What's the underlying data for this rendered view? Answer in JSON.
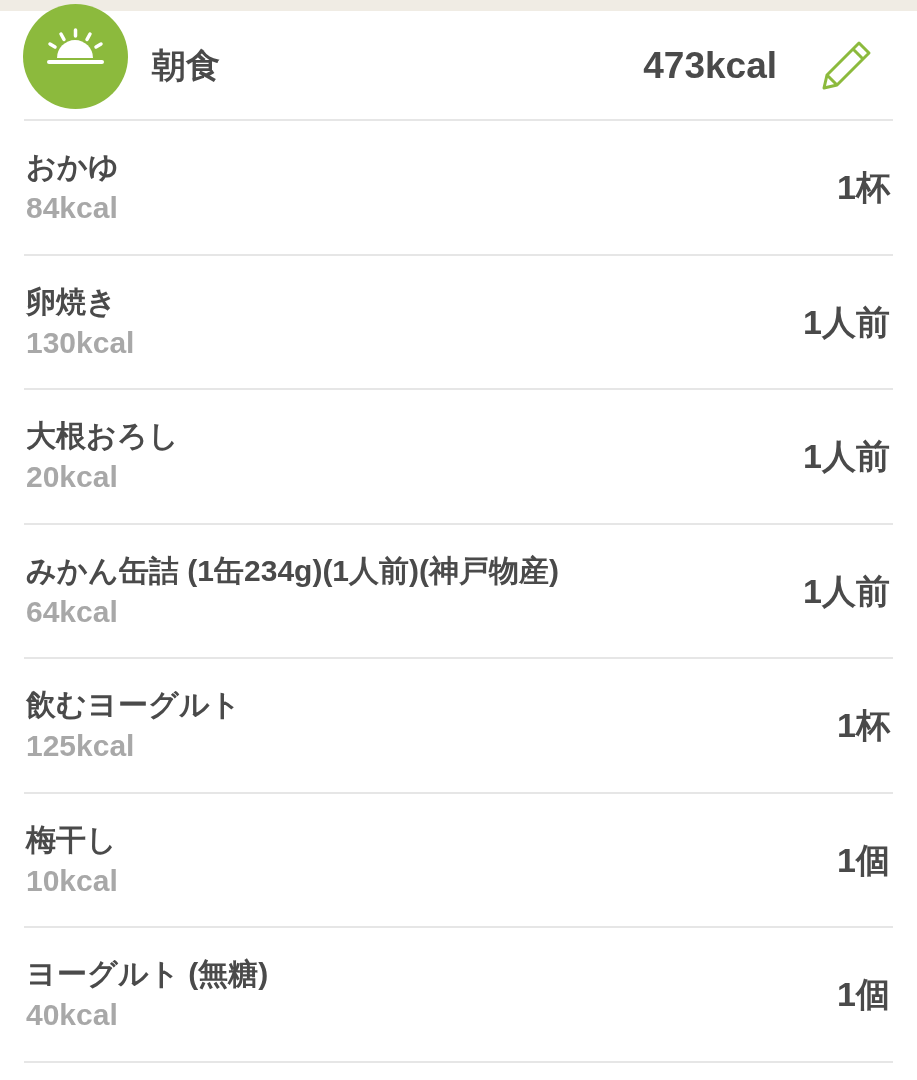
{
  "meal": {
    "title": "朝食",
    "total": "473kcal"
  },
  "items": [
    {
      "name": "おかゆ",
      "calories": "84kcal",
      "quantity": "1杯"
    },
    {
      "name": "卵焼き",
      "calories": "130kcal",
      "quantity": "1人前"
    },
    {
      "name": "大根おろし",
      "calories": "20kcal",
      "quantity": "1人前"
    },
    {
      "name": "みかん缶詰 (1缶234g)(1人前)(神戸物産)",
      "calories": "64kcal",
      "quantity": "1人前"
    },
    {
      "name": "飲むヨーグルト",
      "calories": "125kcal",
      "quantity": "1杯"
    },
    {
      "name": "梅干し",
      "calories": "10kcal",
      "quantity": "1個"
    },
    {
      "name": "ヨーグルト (無糖)",
      "calories": "40kcal",
      "quantity": "1個"
    }
  ]
}
